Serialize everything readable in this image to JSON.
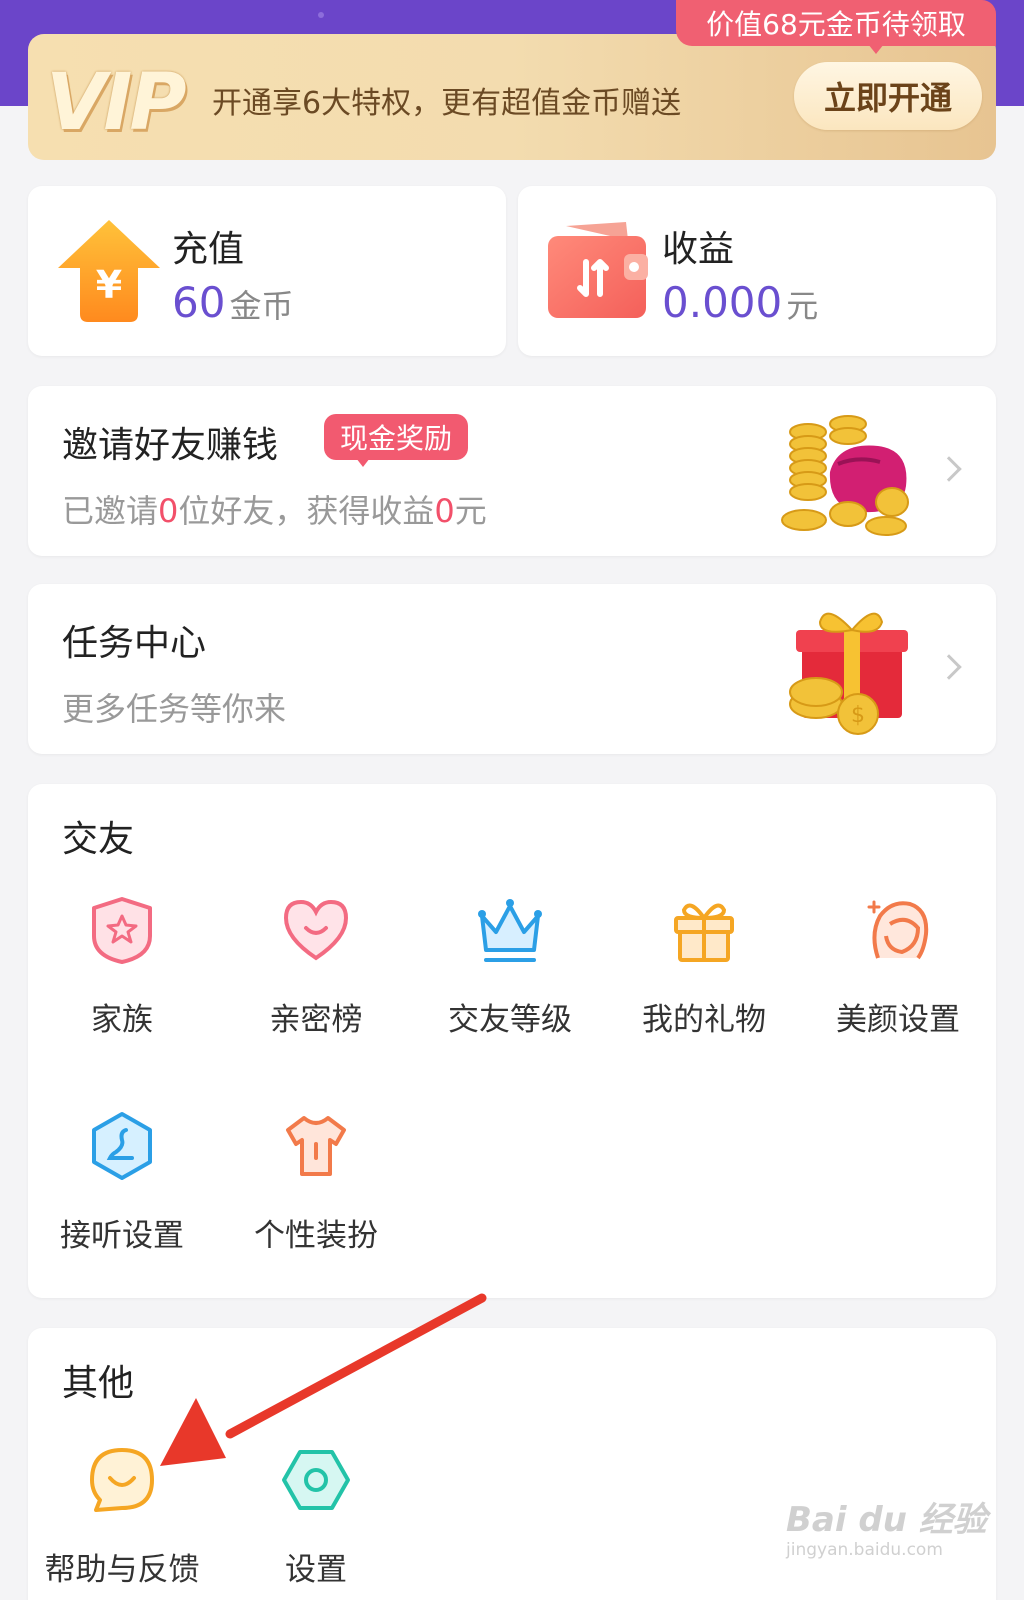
{
  "vip": {
    "logo": "VIP",
    "text": "开通享6大特权，更有超值金币赠送",
    "button_label": "立即开通",
    "badge": "价值68元金币待领取"
  },
  "recharge": {
    "title": "充值",
    "value": "60",
    "unit": "金币",
    "icon": "recharge-house-icon"
  },
  "earnings": {
    "title": "收益",
    "value": "0.000",
    "unit": "元",
    "icon": "wallet-icon"
  },
  "invite": {
    "title": "邀请好友赚钱",
    "tag": "现金奖励",
    "sub_prefix": "已邀请",
    "friends_count": "0",
    "sub_middle": "位好友，获得收益",
    "earned": "0",
    "sub_suffix": "元",
    "image": "coin-bag-illustration"
  },
  "tasks": {
    "title": "任务中心",
    "sub": "更多任务等你来",
    "image": "gift-box-coins-illustration"
  },
  "social": {
    "title": "交友",
    "items": [
      {
        "label": "家族",
        "icon": "family-shield-icon"
      },
      {
        "label": "亲密榜",
        "icon": "heart-icon"
      },
      {
        "label": "交友等级",
        "icon": "crown-icon"
      },
      {
        "label": "我的礼物",
        "icon": "gift-icon"
      },
      {
        "label": "美颜设置",
        "icon": "beauty-face-icon"
      },
      {
        "label": "接听设置",
        "icon": "phone-hexagon-icon"
      },
      {
        "label": "个性装扮",
        "icon": "shirt-icon"
      }
    ]
  },
  "other": {
    "title": "其他",
    "items": [
      {
        "label": "帮助与反馈",
        "icon": "help-chat-icon"
      },
      {
        "label": "设置",
        "icon": "settings-hexagon-icon"
      }
    ]
  },
  "watermark": {
    "brand": "Bai du 经验",
    "url": "jingyan.baidu.com"
  },
  "colors": {
    "purple_header": "#6b45c9",
    "value_purple": "#6a4fd0",
    "pink_tag": "#f25a70",
    "arrow_red": "#e8382a"
  }
}
